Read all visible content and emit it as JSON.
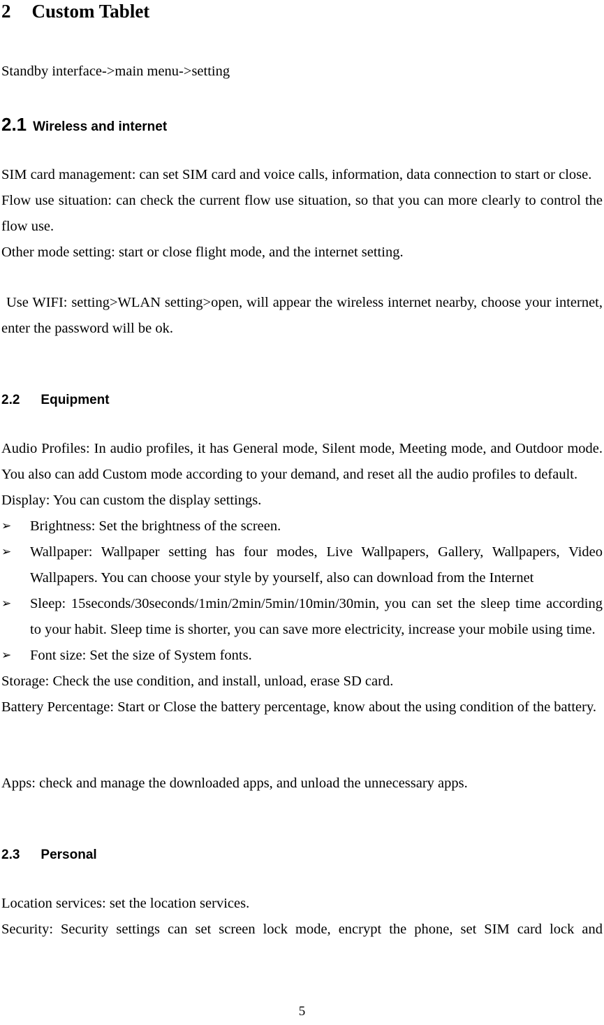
{
  "document": {
    "page_number": "5",
    "chapter": {
      "number": "2",
      "title": "Custom Tablet"
    },
    "intro_line": "Standby interface->main menu->setting",
    "sections": [
      {
        "number": "2.1",
        "title": "Wireless and internet",
        "paragraphs": [
          "SIM card management: can set SIM card and voice calls, information, data connection to start or close.",
          "Flow use situation: can check the current flow use situation, so that you can more clearly to control the flow use.",
          "Other mode setting: start or close flight mode, and the internet setting.",
          "Use WIFI: setting>WLAN setting>open, will appear the wireless internet nearby, choose your internet, enter the password will be ok."
        ]
      },
      {
        "number": "2.2",
        "title": "Equipment",
        "paragraphs": [
          "Audio Profiles: In audio profiles, it has General mode, Silent mode, Meeting mode, and Outdoor mode. You also can add Custom mode according to your demand, and reset all the audio profiles to default.",
          "Display: You can custom the display settings."
        ],
        "bullets": [
          "Brightness: Set the brightness of the screen.",
          "Wallpaper: Wallpaper setting has four modes, Live Wallpapers, Gallery, Wallpapers, Video Wallpapers. You can choose your style by yourself, also can download from the Internet",
          "Sleep: 15seconds/30seconds/1min/2min/5min/10min/30min, you can set the sleep time according to your habit. Sleep time is shorter, you can save more electricity, increase your mobile using time.",
          "Font size: Set the size of System fonts."
        ],
        "paragraphs_after": [
          "Storage: Check the use condition, and install, unload, erase SD card.",
          "Battery Percentage: Start or Close the battery percentage, know about the using condition of the battery.",
          "Apps: check and manage the downloaded apps, and unload the unnecessary apps."
        ]
      },
      {
        "number": "2.3",
        "title": "Personal",
        "paragraphs": [
          "Location services: set the location services.",
          "Security: Security settings can set screen lock mode, encrypt the phone, set SIM card lock and"
        ]
      }
    ],
    "bullet_glyph": "➢"
  }
}
